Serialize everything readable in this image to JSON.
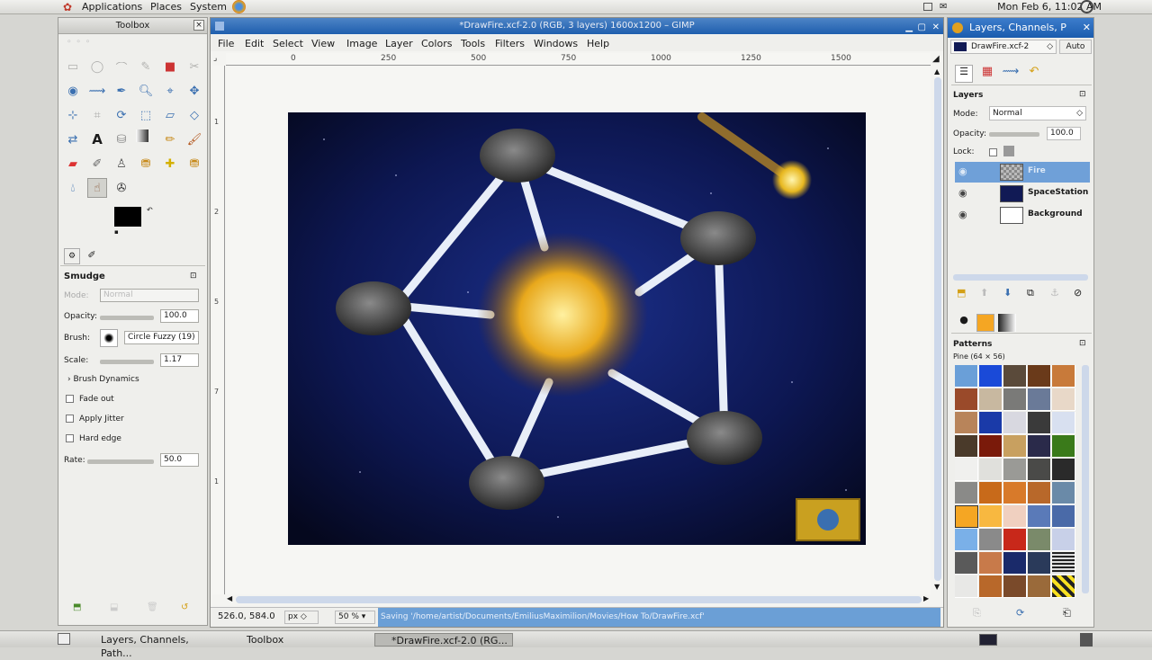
{
  "top_panel": {
    "menus": [
      "Applications",
      "Places",
      "System"
    ],
    "clock": "Mon Feb  6, 11:02 AM"
  },
  "toolbox": {
    "title": "Toolbox",
    "tool_options_title": "Smudge",
    "mode_label": "Mode:",
    "mode_value": "Normal",
    "opacity_label": "Opacity:",
    "opacity_value": "100.0",
    "brush_label": "Brush:",
    "brush_value": "Circle Fuzzy (19)",
    "scale_label": "Scale:",
    "scale_value": "1.17",
    "brush_dynamics": "Brush Dynamics",
    "fade_out": "Fade out",
    "apply_jitter": "Apply Jitter",
    "hard_edge": "Hard edge",
    "rate_label": "Rate:",
    "rate_value": "50.0"
  },
  "image_window": {
    "title": "*DrawFire.xcf-2.0 (RGB, 3 layers) 1600x1200 – GIMP",
    "menu": [
      "File",
      "Edit",
      "Select",
      "View",
      "Image",
      "Layer",
      "Colors",
      "Tools",
      "Filters",
      "Windows",
      "Help"
    ],
    "ruler_ticks": [
      "0",
      "250",
      "500",
      "750",
      "1000",
      "1250",
      "1500"
    ],
    "ruler_v_ticks": [
      "1",
      "2",
      "5",
      "7",
      "1"
    ],
    "coordinates": "526.0, 584.0",
    "unit": "px",
    "zoom": "50 %",
    "status": "Saving '/home/artist/Documents/EmiliusMaximilion/Movies/How To/DrawFire.xcf'"
  },
  "layers_window": {
    "title": "Layers, Channels, P",
    "image_select": "DrawFire.xcf-2",
    "auto_button": "Auto",
    "panel_title": "Layers",
    "mode_label": "Mode:",
    "mode_value": "Normal",
    "opacity_label": "Opacity:",
    "opacity_value": "100.0",
    "lock_label": "Lock:",
    "layers": [
      "Fire",
      "SpaceStation",
      "Background"
    ],
    "patterns_title": "Patterns",
    "pattern_name": "Pine (64 × 56)"
  },
  "taskbar": {
    "tasks": [
      "Layers, Channels, Path...",
      "Toolbox",
      "*DrawFire.xcf-2.0 (RG..."
    ]
  },
  "colors": {
    "accent": "#2a66b8",
    "selected_layer": "#6fa0d8"
  }
}
